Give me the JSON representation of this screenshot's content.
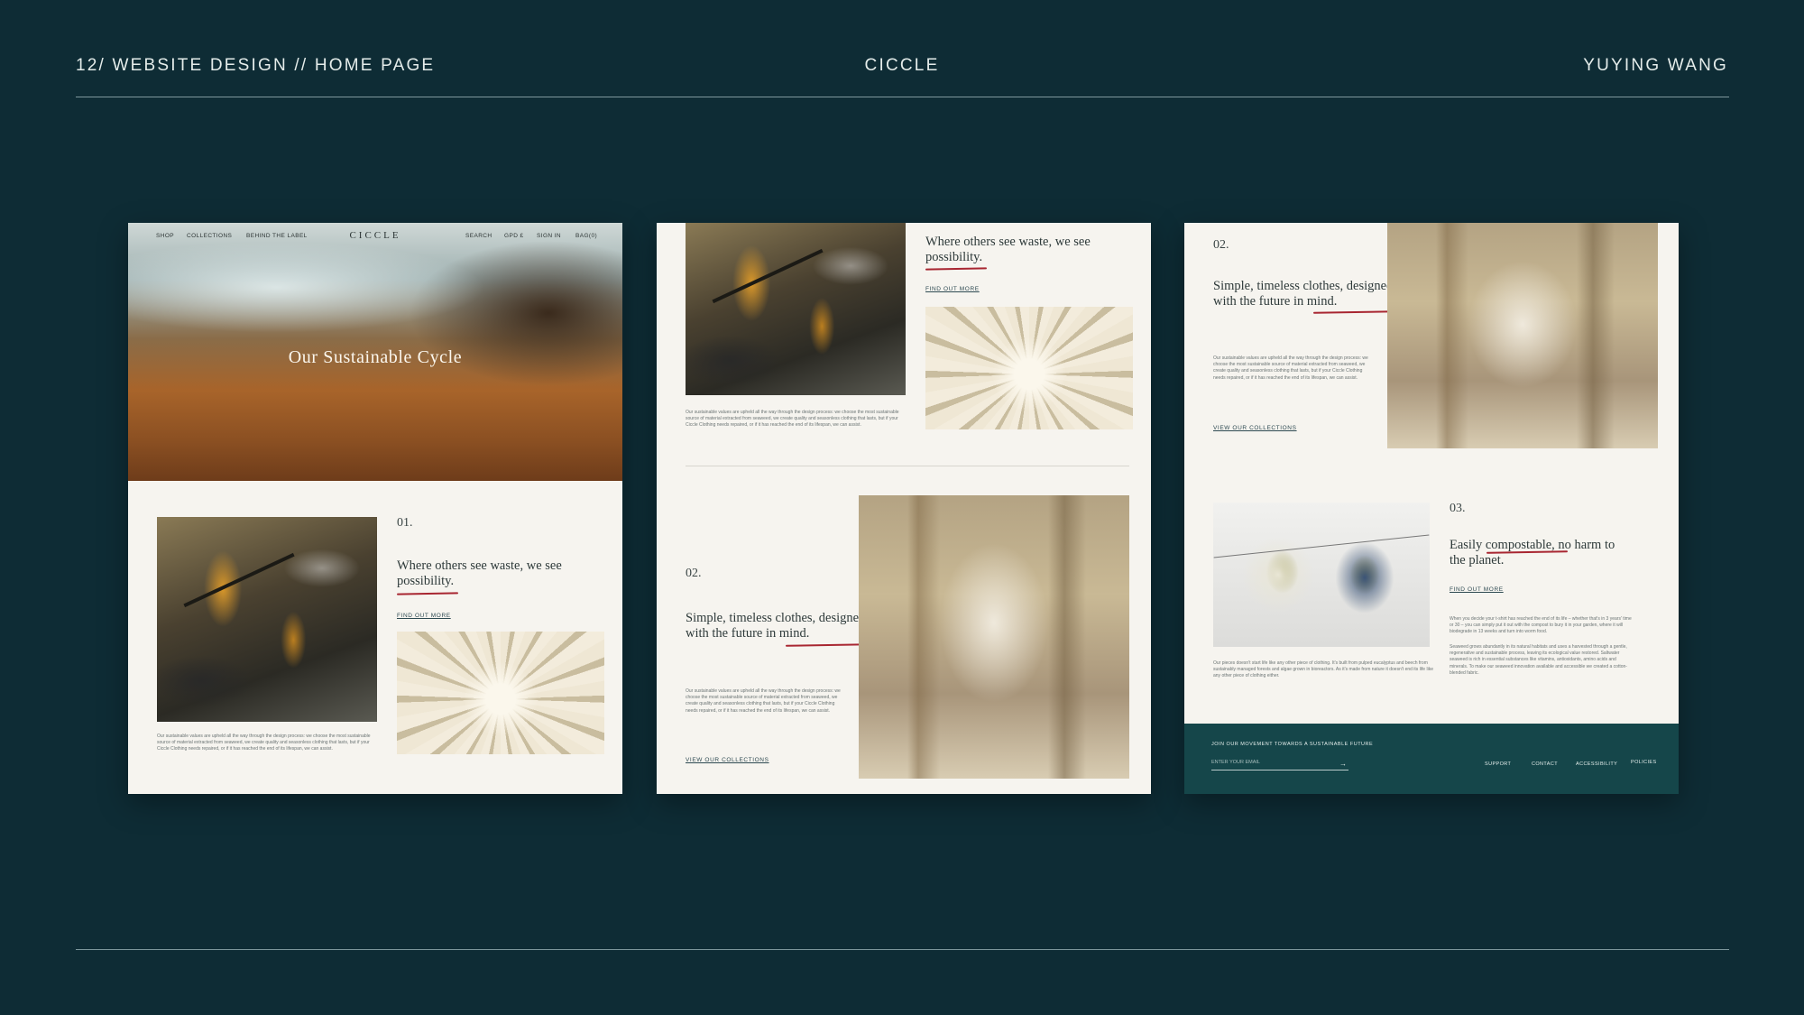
{
  "header": {
    "left": "12/ WEBSITE DESIGN // HOME PAGE",
    "center": "CICCLE",
    "right": "YUYING WANG"
  },
  "panel1": {
    "nav_left": [
      "SHOP",
      "COLLECTIONS",
      "BEHIND THE LABEL"
    ],
    "logo": "CICCLE",
    "nav_right": [
      "SEARCH",
      "GPD £",
      "SIGN IN",
      "BAG(0)"
    ],
    "hero_title": "Our Sustainable Cycle",
    "section_num": "01.",
    "headline": "Where others see waste, we see possibility.",
    "link": "FIND OUT MORE",
    "body": "Our sustainable values are upheld all the way through the design process: we choose the most sustainable source of material extracted from seaweed, we create quality and seasonless clothing that lasts, but if your Ciccle Clothing needs repaired, or if it has reached the end of its lifespan, we can assist."
  },
  "panel2": {
    "headline_top": "Where others see waste, we see possibility.",
    "link_top": "FIND OUT MORE",
    "body_top": "Our sustainable values are upheld all the way through the design process: we choose the most sustainable source of material extracted from seaweed, we create quality and seasonless clothing that lasts, but if your Ciccle Clothing needs repaired, or if it has reached the end of its lifespan, we can assist.",
    "section_num": "02.",
    "headline": "Simple, timeless clothes, designed with the future in mind.",
    "body": "Our sustainable values are upheld all the way through the design process: we choose the most sustainable source of material extracted from seaweed, we create quality and seasonless clothing that lasts, but if your Ciccle Clothing needs repaired, or if it has reached the end of its lifespan, we can assist.",
    "link": "VIEW OUR COLLECTIONS"
  },
  "panel3": {
    "section_num_a": "02.",
    "headline_a": "Simple, timeless clothes, designed with the future in mind.",
    "body_a": "Our sustainable values are upheld all the way through the design process: we choose the most sustainable source of material extracted from seaweed, we create quality and seasonless clothing that lasts, but if your Ciccle Clothing needs repaired, or if it has reached the end of its lifespan, we can assist.",
    "link_a": "VIEW OUR COLLECTIONS",
    "section_num_b": "03.",
    "headline_b": "Easily compostable, no harm to the planet.",
    "link_b": "FIND OUT MORE",
    "body_b1": "When you decide your t-shirt has reached the end of its life – whether that's in 3 years' time or 30 – you can simply put it out with the compost to bury it in your garden, where it will biodegrade in 13 weeks and turn into worm food.",
    "body_b2": "Seaweed grows abundantly in its natural habitats and uses a harvested through a gentle, regenerative and sustainable process, leaving its ecological value restored. Saltwater seaweed is rich in essential substances like vitamins, antioxidants, amino acids and minerals. To make our seaweed innovation available and accessible we created a cotton-blended fabric.",
    "body_left": "Our pieces doesn't start life like any other piece of clothing. It's built from pulped eucalyptus and beech from sustainably managed forests and algae grown in bioreactors. As it's made from nature it doesn't end its life like any other piece of clothing either.",
    "footer": {
      "join": "JOIN OUR MOVEMENT TOWARDS A SUSTAINABLE FUTURE",
      "email_placeholder": "ENTER YOUR EMAIL",
      "arrow": "→",
      "links": [
        "SUPPORT",
        "CONTACT",
        "ACCESSIBILITY",
        "POLICIES"
      ]
    }
  }
}
